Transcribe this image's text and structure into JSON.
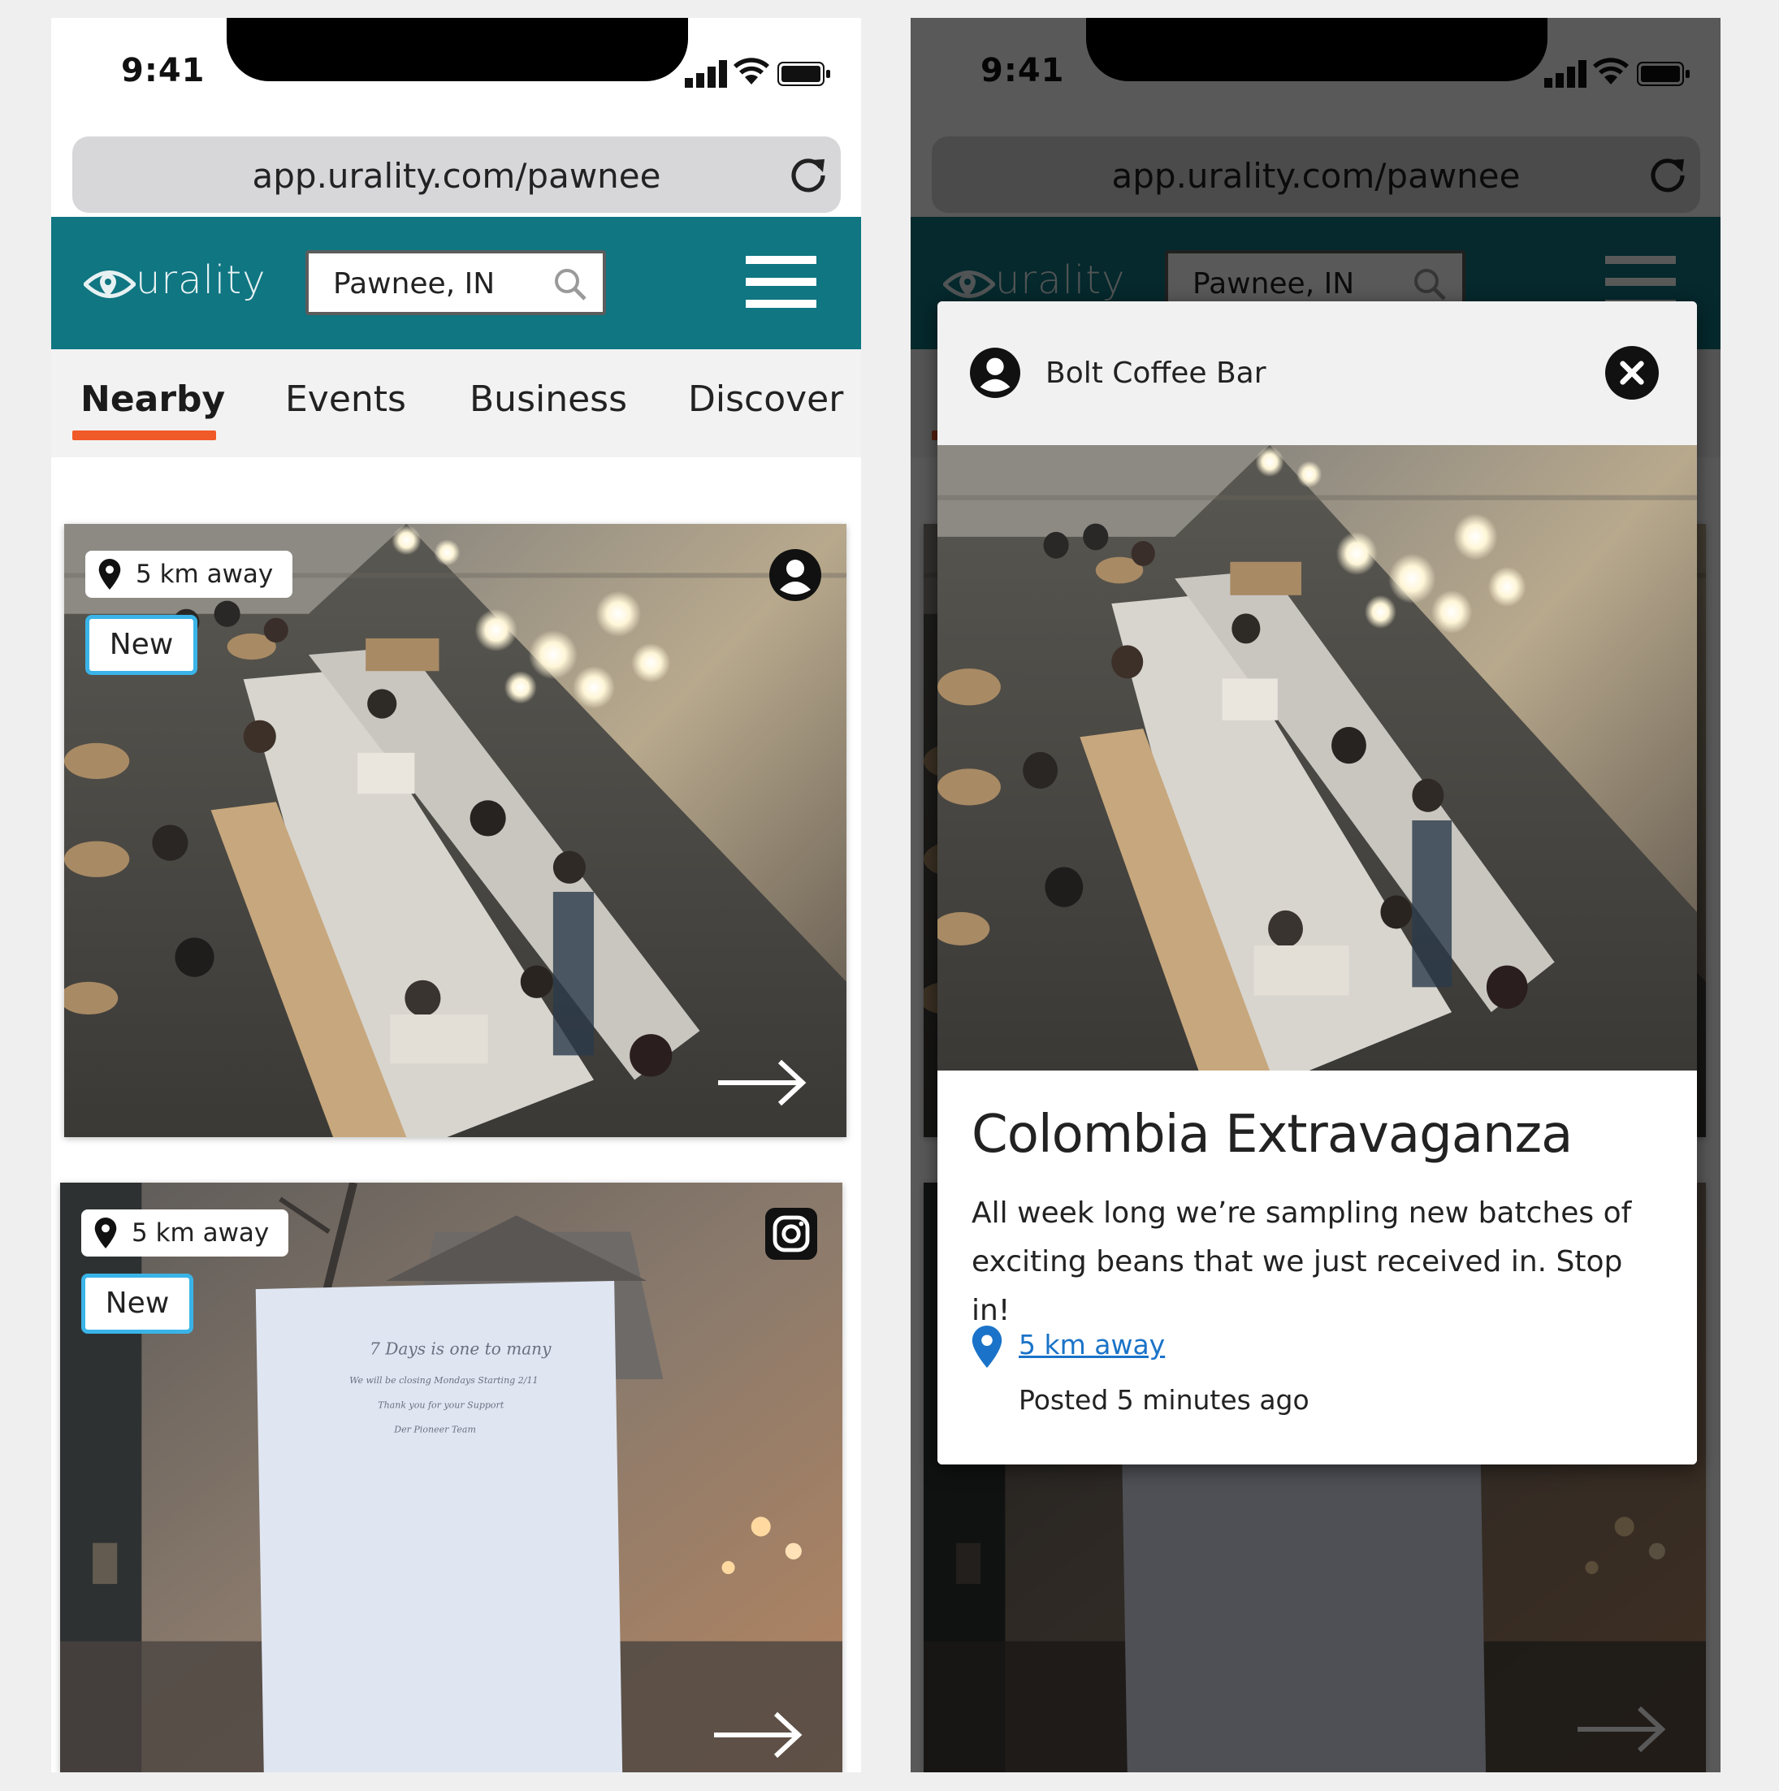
{
  "status": {
    "time": "9:41"
  },
  "browser": {
    "url": "app.urality.com/pawnee"
  },
  "header": {
    "logo_text": "urality",
    "search_value": "Pawnee, IN"
  },
  "tabs": [
    {
      "label": "Nearby",
      "active": true
    },
    {
      "label": "Events"
    },
    {
      "label": "Business"
    },
    {
      "label": "Discover"
    }
  ],
  "feed": {
    "cards": [
      {
        "distance": "5 km away",
        "badge": "New",
        "source_icon": "user-icon"
      },
      {
        "distance": "5 km away",
        "badge": "New",
        "source_icon": "instagram-icon"
      }
    ]
  },
  "modal": {
    "business_name": "Bolt Coffee Bar",
    "title": "Colombia Extravaganza",
    "description": "All week long we’re sampling new batches of exciting beans that we just received in. Stop in!",
    "distance_link": "5 km away",
    "posted": "Posted 5 minutes ago"
  },
  "colors": {
    "header_teal": "#0f7682",
    "tab_underline": "#f05a28",
    "badge_border": "#3ab4e8",
    "link_blue": "#1a73c8"
  }
}
